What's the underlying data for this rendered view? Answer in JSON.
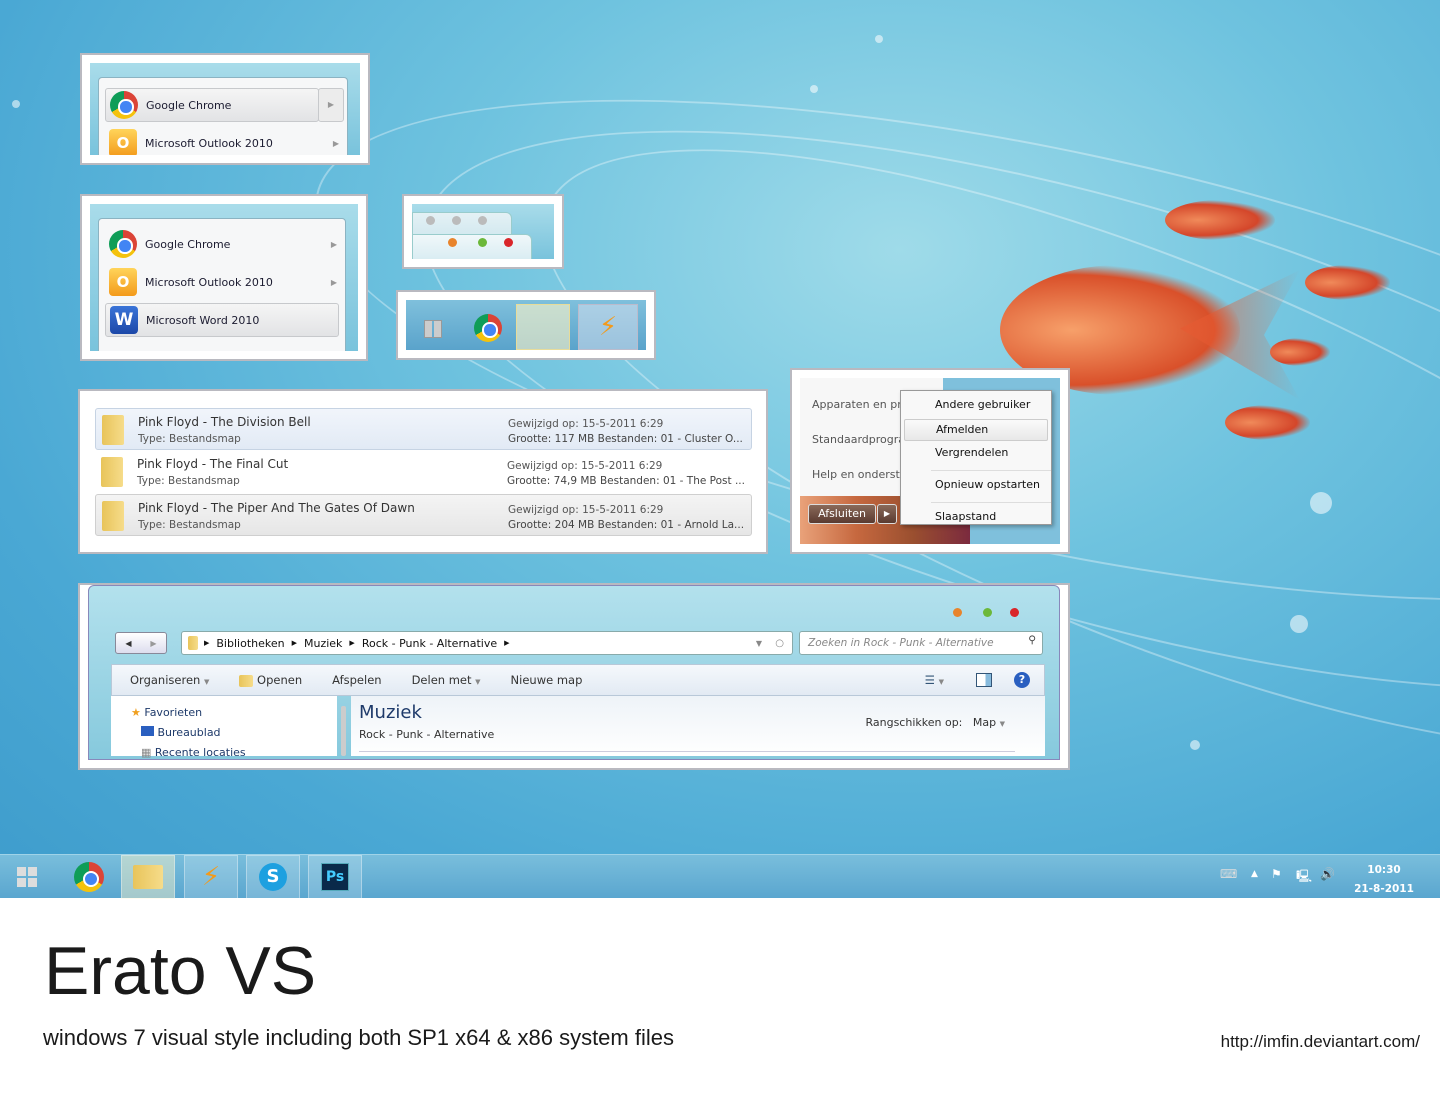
{
  "startmenu_a": {
    "items": [
      {
        "label": "Google Chrome",
        "icon": "chrome-icon"
      },
      {
        "label": "Microsoft Outlook 2010",
        "icon": "outlook-icon"
      }
    ]
  },
  "startmenu_b": {
    "items": [
      {
        "label": "Google Chrome",
        "icon": "chrome-icon"
      },
      {
        "label": "Microsoft Outlook 2010",
        "icon": "outlook-icon"
      },
      {
        "label": "Microsoft Word 2010",
        "icon": "word-icon"
      }
    ]
  },
  "caption_buttons": {
    "colors": {
      "minimize": "#e8842c",
      "maximize": "#6cb83a",
      "close": "#d9262a"
    }
  },
  "files": [
    {
      "name": "Pink Floyd - The Division Bell",
      "type": "Type: Bestandsmap",
      "modified": "Gewijzigd op: 15-5-2011 6:29",
      "details": "Grootte: 117 MB   Bestanden: 01 - Cluster O..."
    },
    {
      "name": "Pink Floyd - The Final Cut",
      "type": "Type: Bestandsmap",
      "modified": "Gewijzigd op: 15-5-2011 6:29",
      "details": "Grootte: 74,9 MB   Bestanden: 01 - The Post ..."
    },
    {
      "name": "Pink Floyd - The Piper And The Gates Of Dawn",
      "type": "Type: Bestandsmap",
      "modified": "Gewijzigd op: 15-5-2011 6:29",
      "details": "Grootte: 204 MB   Bestanden: 01 - Arnold La..."
    }
  ],
  "shutdown": {
    "left_items": [
      "Apparaten en pri",
      "Standaardprogra",
      "Help en onderste"
    ],
    "button_label": "Afsluiten",
    "menu": [
      "Andere gebruiker",
      "Afmelden",
      "Vergrendelen",
      "Opnieuw opstarten",
      "Slaapstand"
    ]
  },
  "explorer": {
    "breadcrumb": [
      "Bibliotheken",
      "Muziek",
      "Rock - Punk - Alternative"
    ],
    "search_placeholder": "Zoeken in Rock - Punk - Alternative",
    "toolbar": {
      "organize": "Organiseren",
      "open": "Openen",
      "play": "Afspelen",
      "share": "Delen met",
      "new_folder": "Nieuwe map"
    },
    "nav": {
      "favorites": "Favorieten",
      "desktop": "Bureaublad",
      "recent": "Recente locaties"
    },
    "title": "Muziek",
    "subtitle": "Rock - Punk - Alternative",
    "arrange_label": "Rangschikken op:",
    "arrange_value": "Map"
  },
  "taskbar": {
    "apps": [
      "start-icon",
      "chrome-icon",
      "explorer-icon",
      "winamp-icon",
      "skype-icon",
      "photoshop-icon"
    ],
    "photoshop_label": "Ps",
    "time": "10:30",
    "date": "21-8-2011"
  },
  "caption": {
    "title": "Erato VS",
    "subtitle": "windows 7 visual style including both SP1 x64 & x86 system files",
    "url": "http://imfin.deviantart.com/"
  }
}
